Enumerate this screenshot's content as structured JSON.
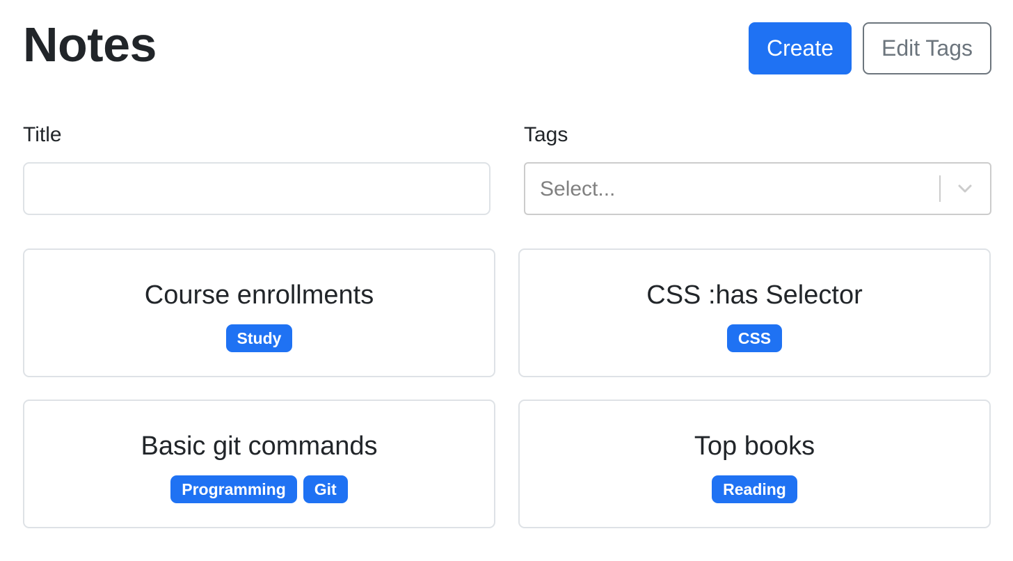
{
  "header": {
    "title": "Notes",
    "create_label": "Create",
    "edit_tags_label": "Edit Tags"
  },
  "filters": {
    "title_label": "Title",
    "title_value": "",
    "tags_label": "Tags",
    "tags_placeholder": "Select..."
  },
  "colors": {
    "primary": "#1f72f3",
    "outline": "#6c757d",
    "border": "#dee2e6"
  },
  "notes": [
    {
      "title": "Course enrollments",
      "tags": [
        "Study"
      ]
    },
    {
      "title": "CSS :has Selector",
      "tags": [
        "CSS"
      ]
    },
    {
      "title": "Basic git commands",
      "tags": [
        "Programming",
        "Git"
      ]
    },
    {
      "title": "Top books",
      "tags": [
        "Reading"
      ]
    }
  ]
}
